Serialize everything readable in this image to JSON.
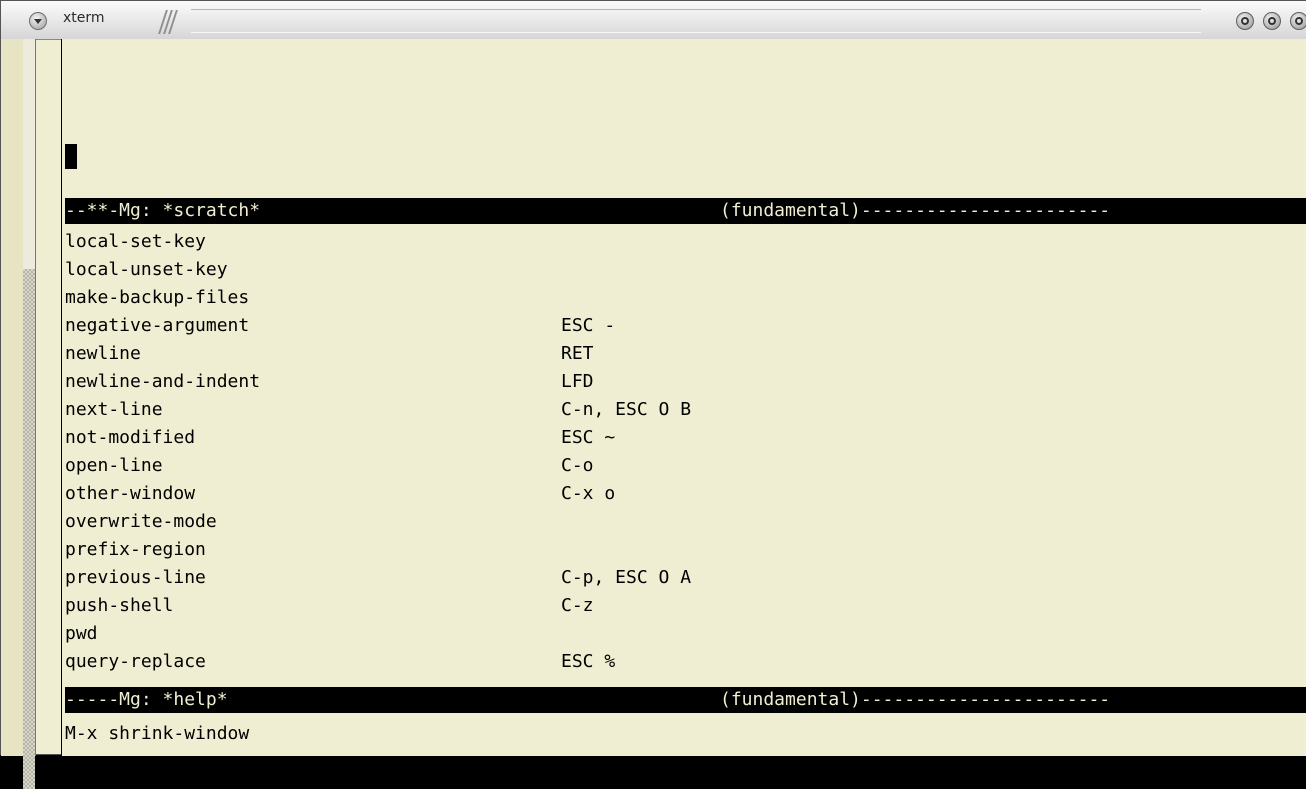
{
  "window": {
    "title": "xterm",
    "controls": [
      "menu-icon",
      "minimize-icon",
      "maximize-icon",
      "close-icon"
    ]
  },
  "editor": {
    "top_modeline": {
      "left": "--**-Mg: *scratch*",
      "right": "(fundamental)-----------------------"
    },
    "help_rows": [
      {
        "command": "local-set-key",
        "binding": ""
      },
      {
        "command": "local-unset-key",
        "binding": ""
      },
      {
        "command": "make-backup-files",
        "binding": ""
      },
      {
        "command": "negative-argument",
        "binding": "ESC -"
      },
      {
        "command": "newline",
        "binding": "RET"
      },
      {
        "command": "newline-and-indent",
        "binding": "LFD"
      },
      {
        "command": "next-line",
        "binding": "C-n, ESC O B"
      },
      {
        "command": "not-modified",
        "binding": "ESC ~"
      },
      {
        "command": "open-line",
        "binding": "C-o"
      },
      {
        "command": "other-window",
        "binding": "C-x o"
      },
      {
        "command": "overwrite-mode",
        "binding": ""
      },
      {
        "command": "prefix-region",
        "binding": ""
      },
      {
        "command": "previous-line",
        "binding": "C-p, ESC O A"
      },
      {
        "command": "push-shell",
        "binding": "C-z"
      },
      {
        "command": "pwd",
        "binding": ""
      },
      {
        "command": "query-replace",
        "binding": "ESC %"
      }
    ],
    "bottom_modeline": {
      "left": "-----Mg: *help*",
      "right": "(fundamental)-----------------------"
    },
    "minibuffer": "M-x shrink-window"
  }
}
